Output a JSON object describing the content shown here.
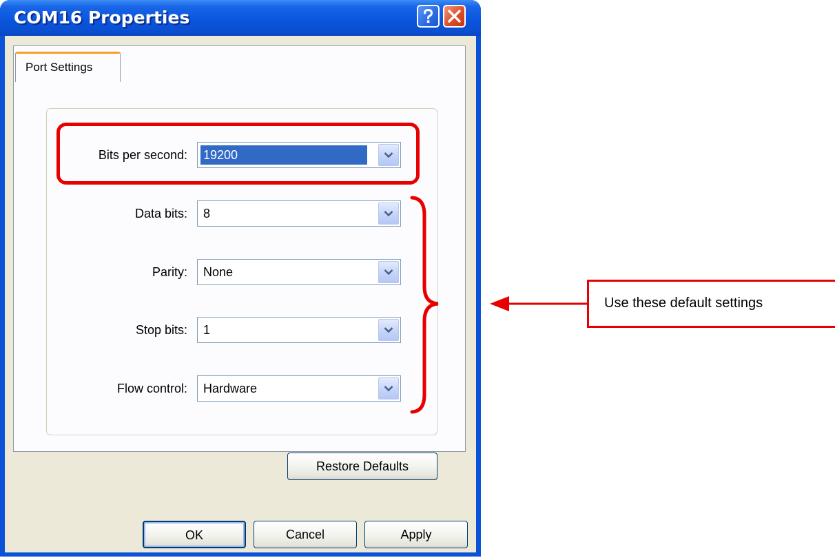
{
  "window": {
    "title": "COM16 Properties"
  },
  "tabs": [
    {
      "label": "Port Settings",
      "active": true
    }
  ],
  "fields": [
    {
      "label": "Bits per second:",
      "value": "19200",
      "selected": true
    },
    {
      "label": "Data bits:",
      "value": "8"
    },
    {
      "label": "Parity:",
      "value": "None"
    },
    {
      "label": "Stop bits:",
      "value": "1"
    },
    {
      "label": "Flow control:",
      "value": "Hardware"
    }
  ],
  "buttons": {
    "restore_defaults": "Restore Defaults",
    "ok": "OK",
    "cancel": "Cancel",
    "apply": "Apply"
  },
  "annotation": {
    "callout_text": "Use these default settings",
    "color": "#e60000"
  },
  "icons": {
    "help": "question-mark-icon",
    "close": "close-x-icon",
    "dropdown": "chevron-down-icon"
  }
}
